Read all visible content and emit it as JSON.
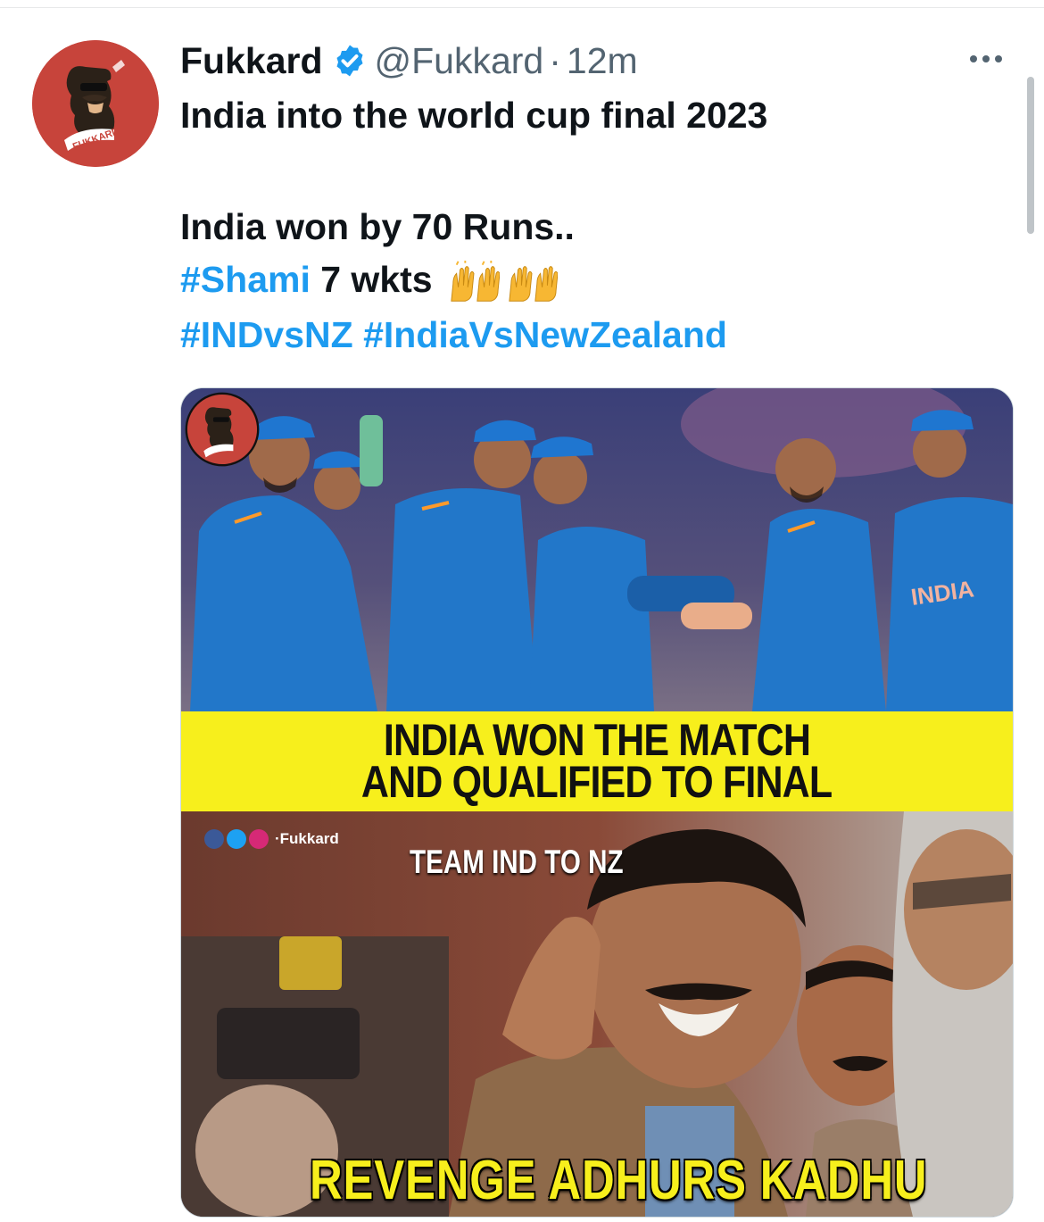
{
  "tweet": {
    "display_name": "Fukkard",
    "handle": "@Fukkard",
    "separator": "·",
    "time": "12m",
    "line1": "India into the world cup final 2023",
    "line2": "India won by 70 Runs..",
    "hashtag_shami": "#Shami",
    "shami_text": " 7 wkts",
    "hashtag_indvsnz": "#INDvsNZ",
    "hashtag_indiavsnz": "#IndiaVsNewZealand",
    "emoji": "raising-hands"
  },
  "media": {
    "banner_line1": "INDIA WON THE MATCH",
    "banner_line2": "AND QUALIFIED TO FINAL",
    "social_credit": "·Fukkard",
    "team_caption": "TEAM IND TO NZ",
    "bottom_caption": "REVENGE ADHURS KADHU",
    "watermark_text": "FUKKARD"
  },
  "colors": {
    "link": "#1d9bf0",
    "text": "#0f1419",
    "muted": "#536471",
    "avatar_bg": "#c7443b",
    "banner_bg": "#f7ef1c",
    "jersey_blue": "#2277c9"
  }
}
